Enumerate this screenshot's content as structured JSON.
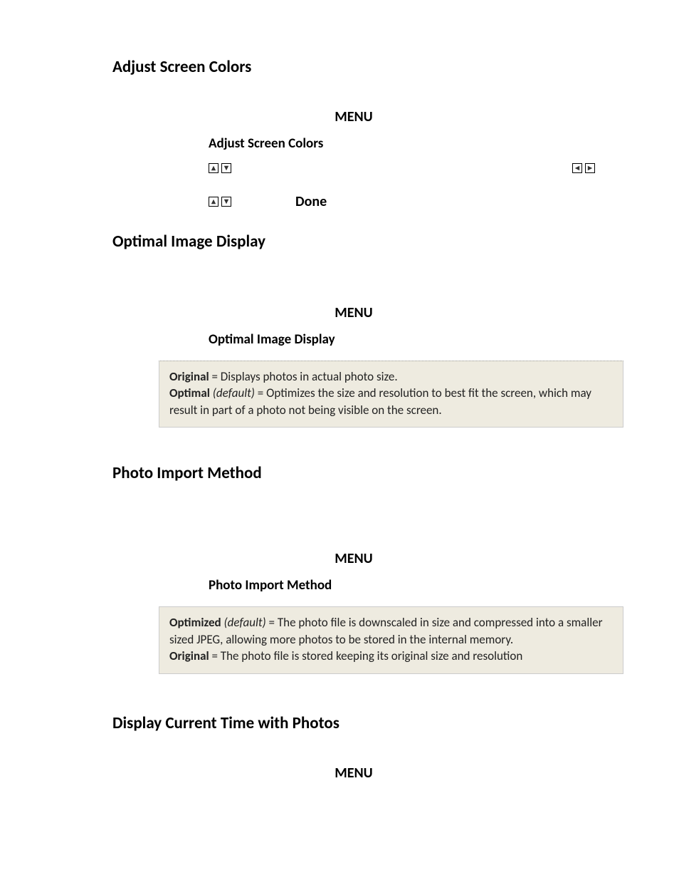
{
  "sections": {
    "adjust": {
      "heading": "Adjust Screen Colors",
      "menu": "MENU",
      "sub": "Adjust Screen Colors",
      "done": "Done"
    },
    "optimal": {
      "heading": "Optimal Image Display",
      "menu": "MENU",
      "sub": "Optimal Image Display",
      "note": {
        "original_label": "Original",
        "original_text": " = Displays photos in actual photo size.",
        "optimal_label": "Optimal",
        "optimal_default": " (default)",
        "optimal_text": " = Optimizes the size and resolution to best fit the screen, which may result in part of a photo not being visible on the screen."
      }
    },
    "import": {
      "heading": "Photo Import Method",
      "menu": "MENU",
      "sub": "Photo Import Method",
      "note": {
        "optimized_label": "Optimized",
        "optimized_default": " (default)",
        "optimized_text": " = The photo file is downscaled in size and compressed into a smaller sized JPEG, allowing more photos to be stored in the internal memory.",
        "original_label": "Original",
        "original_text": " = The photo file is stored keeping its original size and resolution"
      }
    },
    "time": {
      "heading": "Display Current Time with Photos",
      "menu": "MENU"
    }
  }
}
